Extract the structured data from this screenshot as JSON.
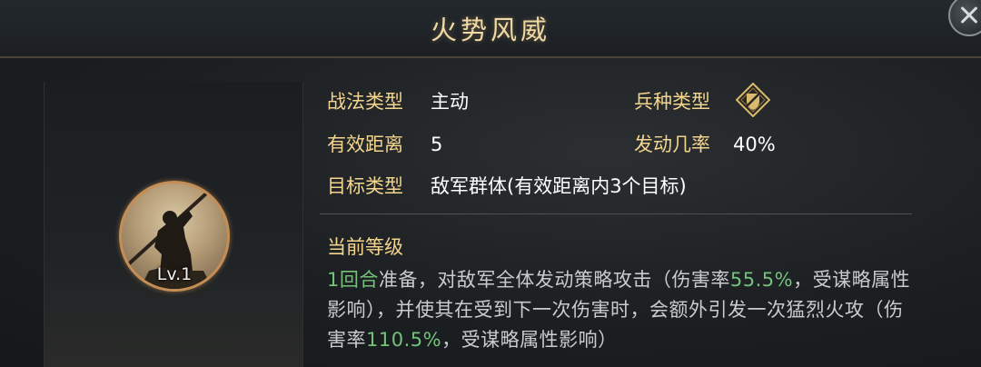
{
  "title": "火势风威",
  "skill": {
    "level": "Lv.1",
    "portrait": "warrior-with-spear"
  },
  "info": {
    "type_label": "战法类型",
    "type_value": "主动",
    "troop_label": "兵种类型",
    "troop_icon": "troop-type-icon",
    "range_label": "有效距离",
    "range_value": "5",
    "rate_label": "发动几率",
    "rate_value": "40%",
    "target_label": "目标类型",
    "target_value": "敌军群体(有效距离内3个目标)"
  },
  "current": {
    "heading": "当前等级",
    "p1": "1回合",
    "p2": "准备，对敌军全体发动策略攻击（伤害率",
    "p3": "55.5%",
    "p4": "，受谋略属性影响），并使其在受到下一次伤害时，会额外引发一次猛烈火攻（伤害率",
    "p5": "110.5%",
    "p6": "，受谋略属性影响）"
  },
  "colors": {
    "label": "#f3d58e",
    "value": "#ffffff",
    "highlight": "#74c17a",
    "description": "#c9cccf",
    "ring": "#c58e55"
  }
}
